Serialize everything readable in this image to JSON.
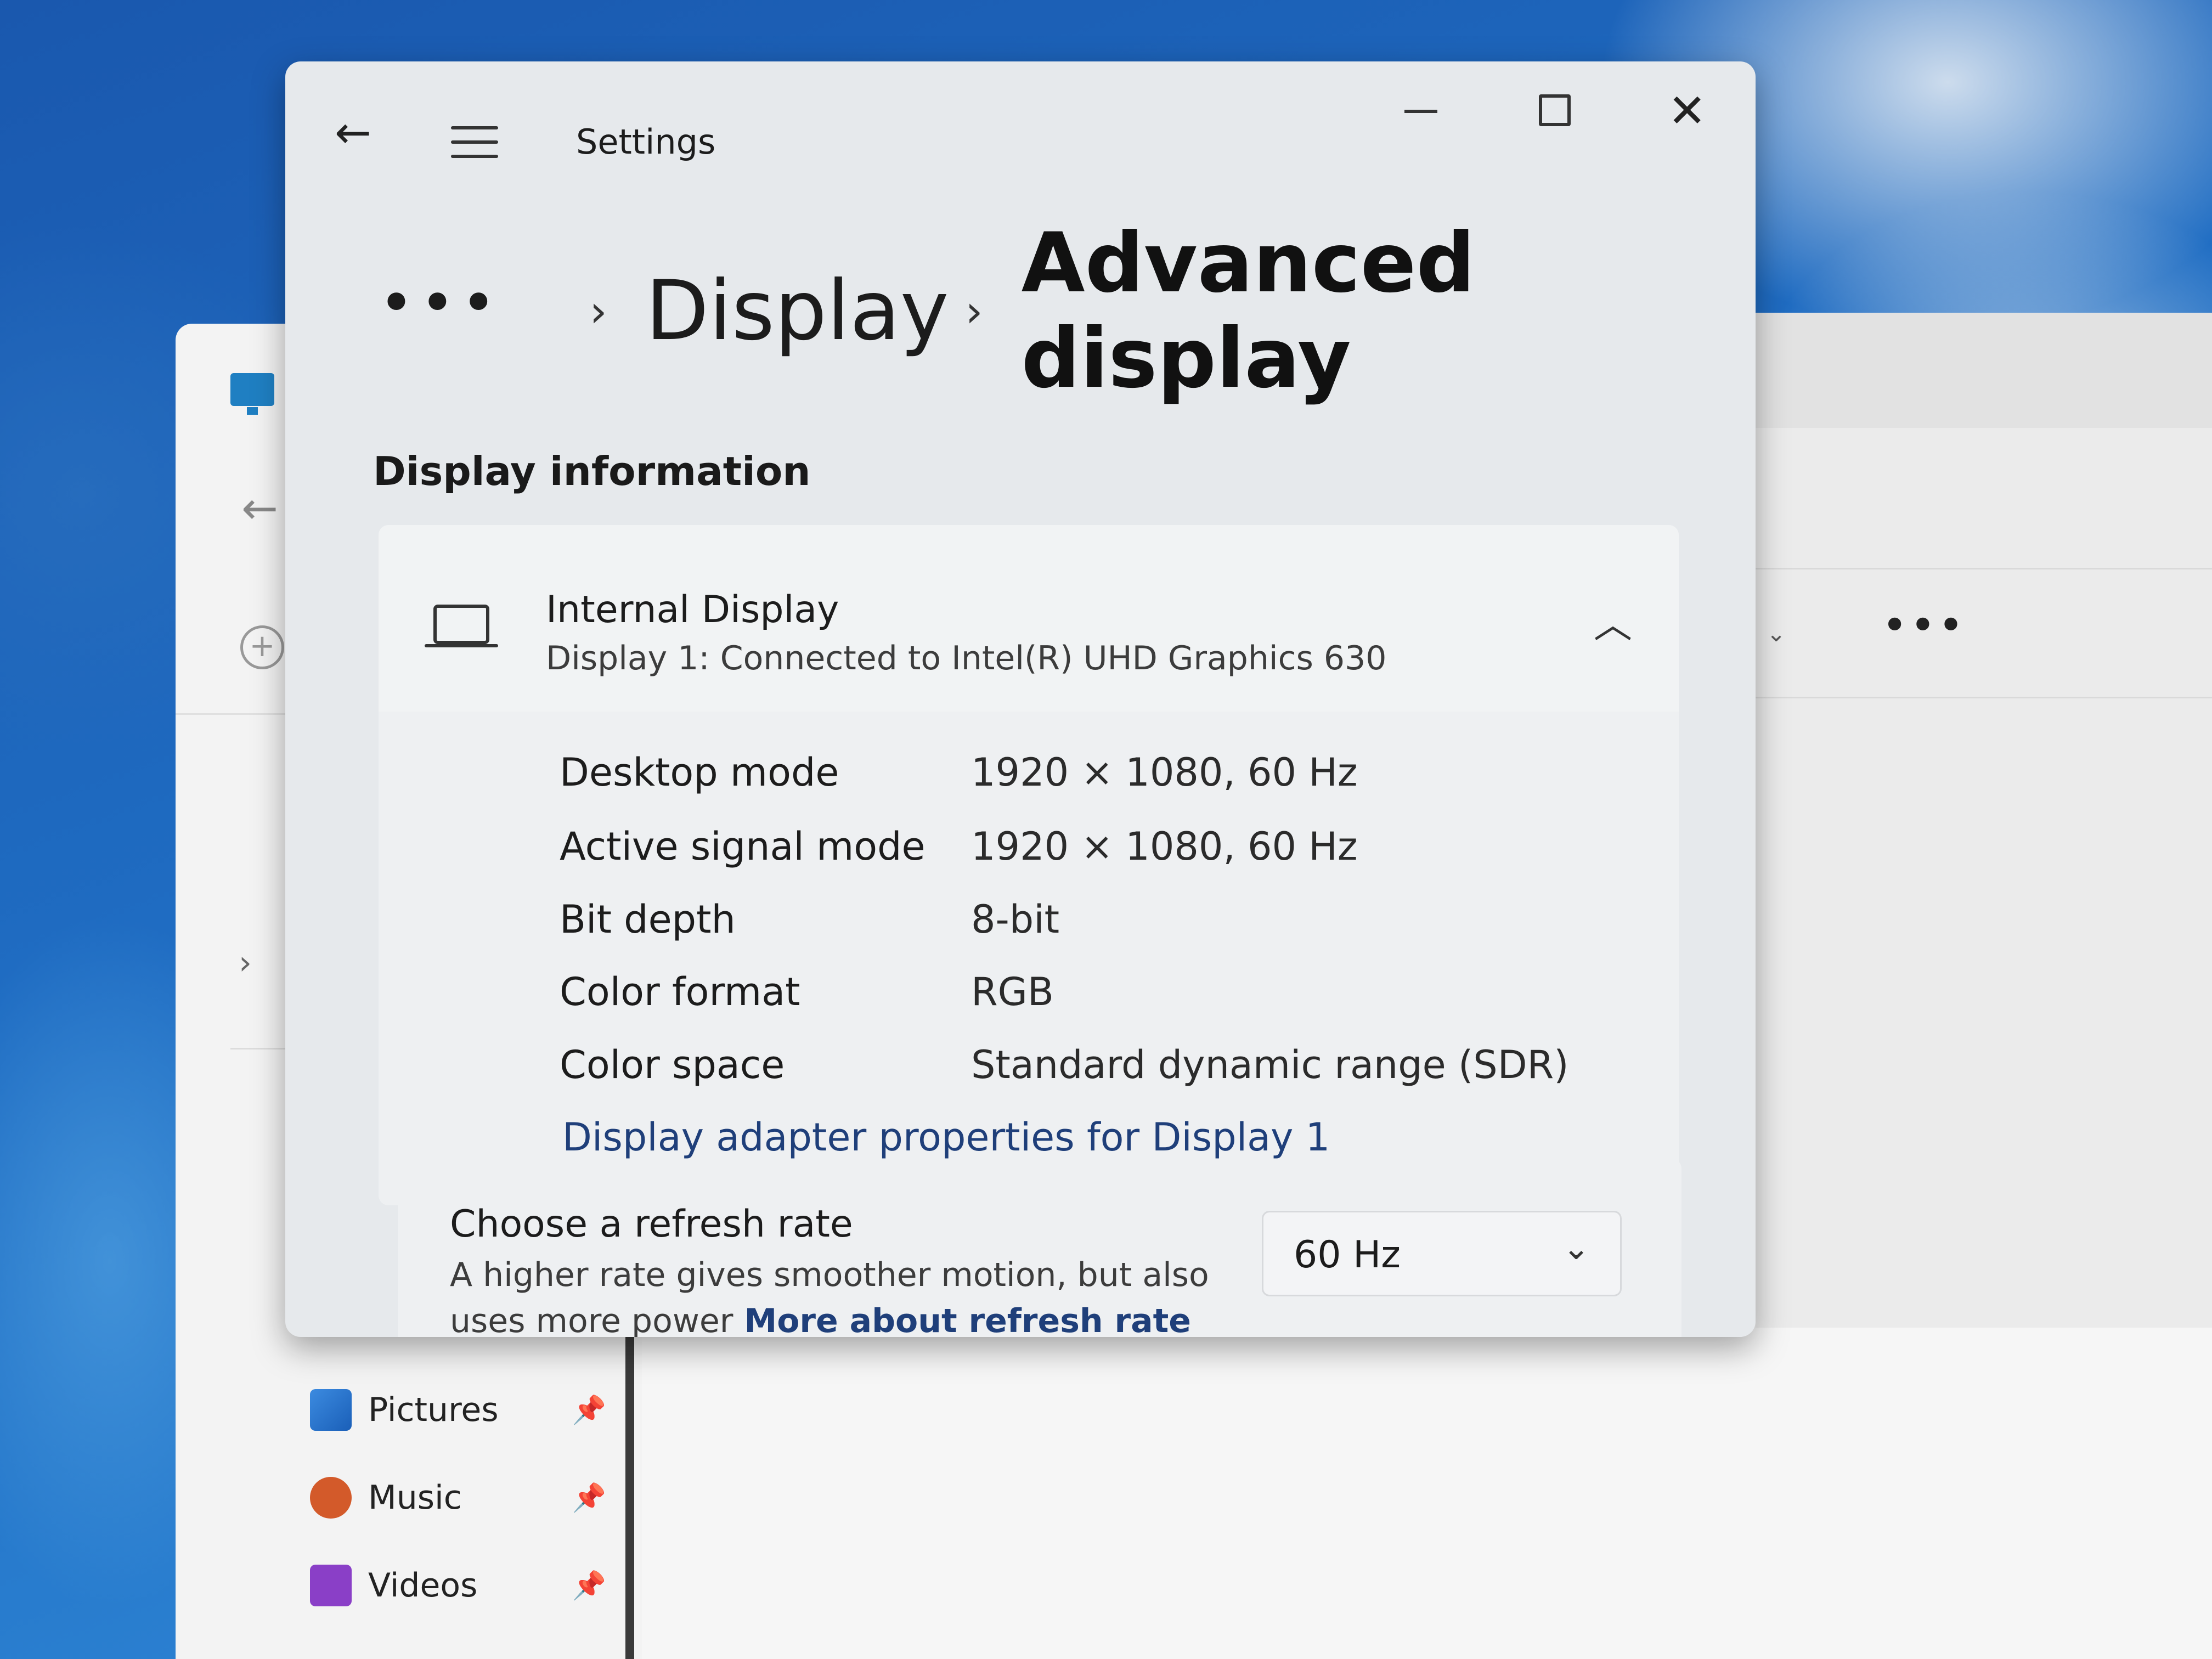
{
  "settings": {
    "app_title": "Settings",
    "breadcrumb": {
      "more": "•••",
      "sep": "›",
      "parent": "Display",
      "current": "Advanced display"
    },
    "section_title": "Display information",
    "display": {
      "name": "Internal Display",
      "subtitle": "Display 1: Connected to Intel(R) UHD Graphics 630",
      "rows": [
        {
          "label": "Desktop mode",
          "value": "1920 × 1080, 60 Hz"
        },
        {
          "label": "Active signal mode",
          "value": "1920 × 1080, 60 Hz"
        },
        {
          "label": "Bit depth",
          "value": "8-bit"
        },
        {
          "label": "Color format",
          "value": "RGB"
        },
        {
          "label": "Color space",
          "value": "Standard dynamic range (SDR)"
        }
      ],
      "adapter_link": "Display adapter properties for Display 1"
    },
    "refresh": {
      "title": "Choose a refresh rate",
      "description": "A higher rate gives smoother motion, but also uses more power",
      "link": "More about refresh rate",
      "selected": "60 Hz"
    }
  },
  "explorer": {
    "quick_access": [
      {
        "label": "Pictures"
      },
      {
        "label": "Music"
      },
      {
        "label": "Videos"
      }
    ],
    "more": "•••"
  },
  "colors": {
    "accent_link": "#1f3f7a",
    "window_bg": "#e6e9ec"
  },
  "icons": {
    "back": "back-arrow-icon",
    "menu": "hamburger-menu-icon",
    "minimize": "minimize-icon",
    "maximize": "maximize-icon",
    "close": "close-icon",
    "display": "laptop-icon",
    "collapse": "chevron-up-icon",
    "dropdown": "chevron-down-icon"
  }
}
